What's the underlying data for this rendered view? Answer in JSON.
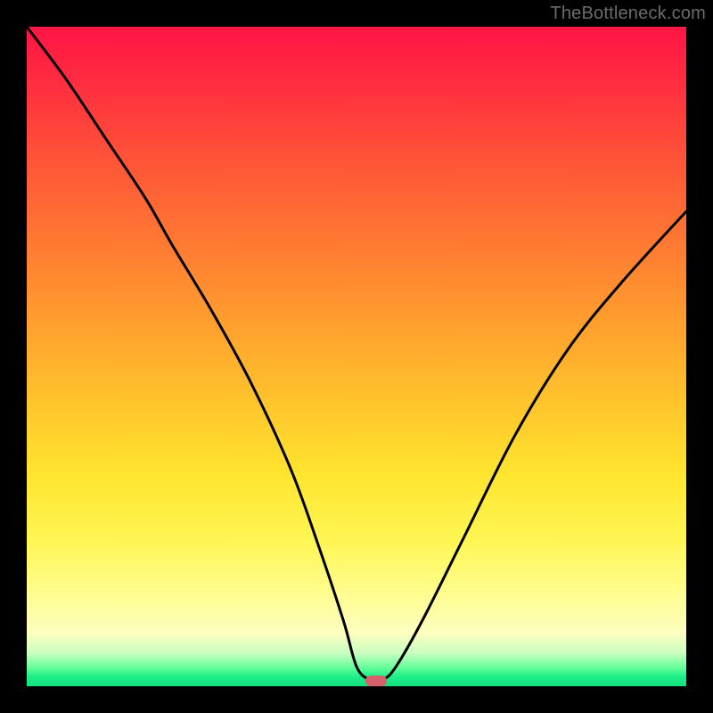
{
  "watermark": "TheBottleneck.com",
  "chart_data": {
    "type": "line",
    "title": "",
    "xlabel": "",
    "ylabel": "",
    "xlim": [
      0,
      100
    ],
    "ylim": [
      0,
      100
    ],
    "grid": false,
    "legend": false,
    "series": [
      {
        "name": "bottleneck-curve",
        "x": [
          0,
          6,
          12,
          18,
          22,
          28,
          34,
          40,
          44,
          48,
          50,
          52,
          54,
          56,
          60,
          66,
          74,
          82,
          90,
          100
        ],
        "y": [
          100,
          92,
          83,
          74,
          67,
          57,
          46,
          33,
          22,
          10,
          3,
          1,
          1,
          3,
          10,
          22,
          38,
          51,
          61,
          72
        ]
      }
    ],
    "marker": {
      "x": 53,
      "y": 0.8,
      "color": "#d8606a"
    },
    "background_gradient": {
      "direction": "top-to-bottom",
      "stops": [
        {
          "pct": 0,
          "color": "#ff1545"
        },
        {
          "pct": 20,
          "color": "#ff5338"
        },
        {
          "pct": 46,
          "color": "#ffa22e"
        },
        {
          "pct": 68,
          "color": "#ffe52f"
        },
        {
          "pct": 92,
          "color": "#fcffc0"
        },
        {
          "pct": 100,
          "color": "#14e07f"
        }
      ]
    }
  }
}
